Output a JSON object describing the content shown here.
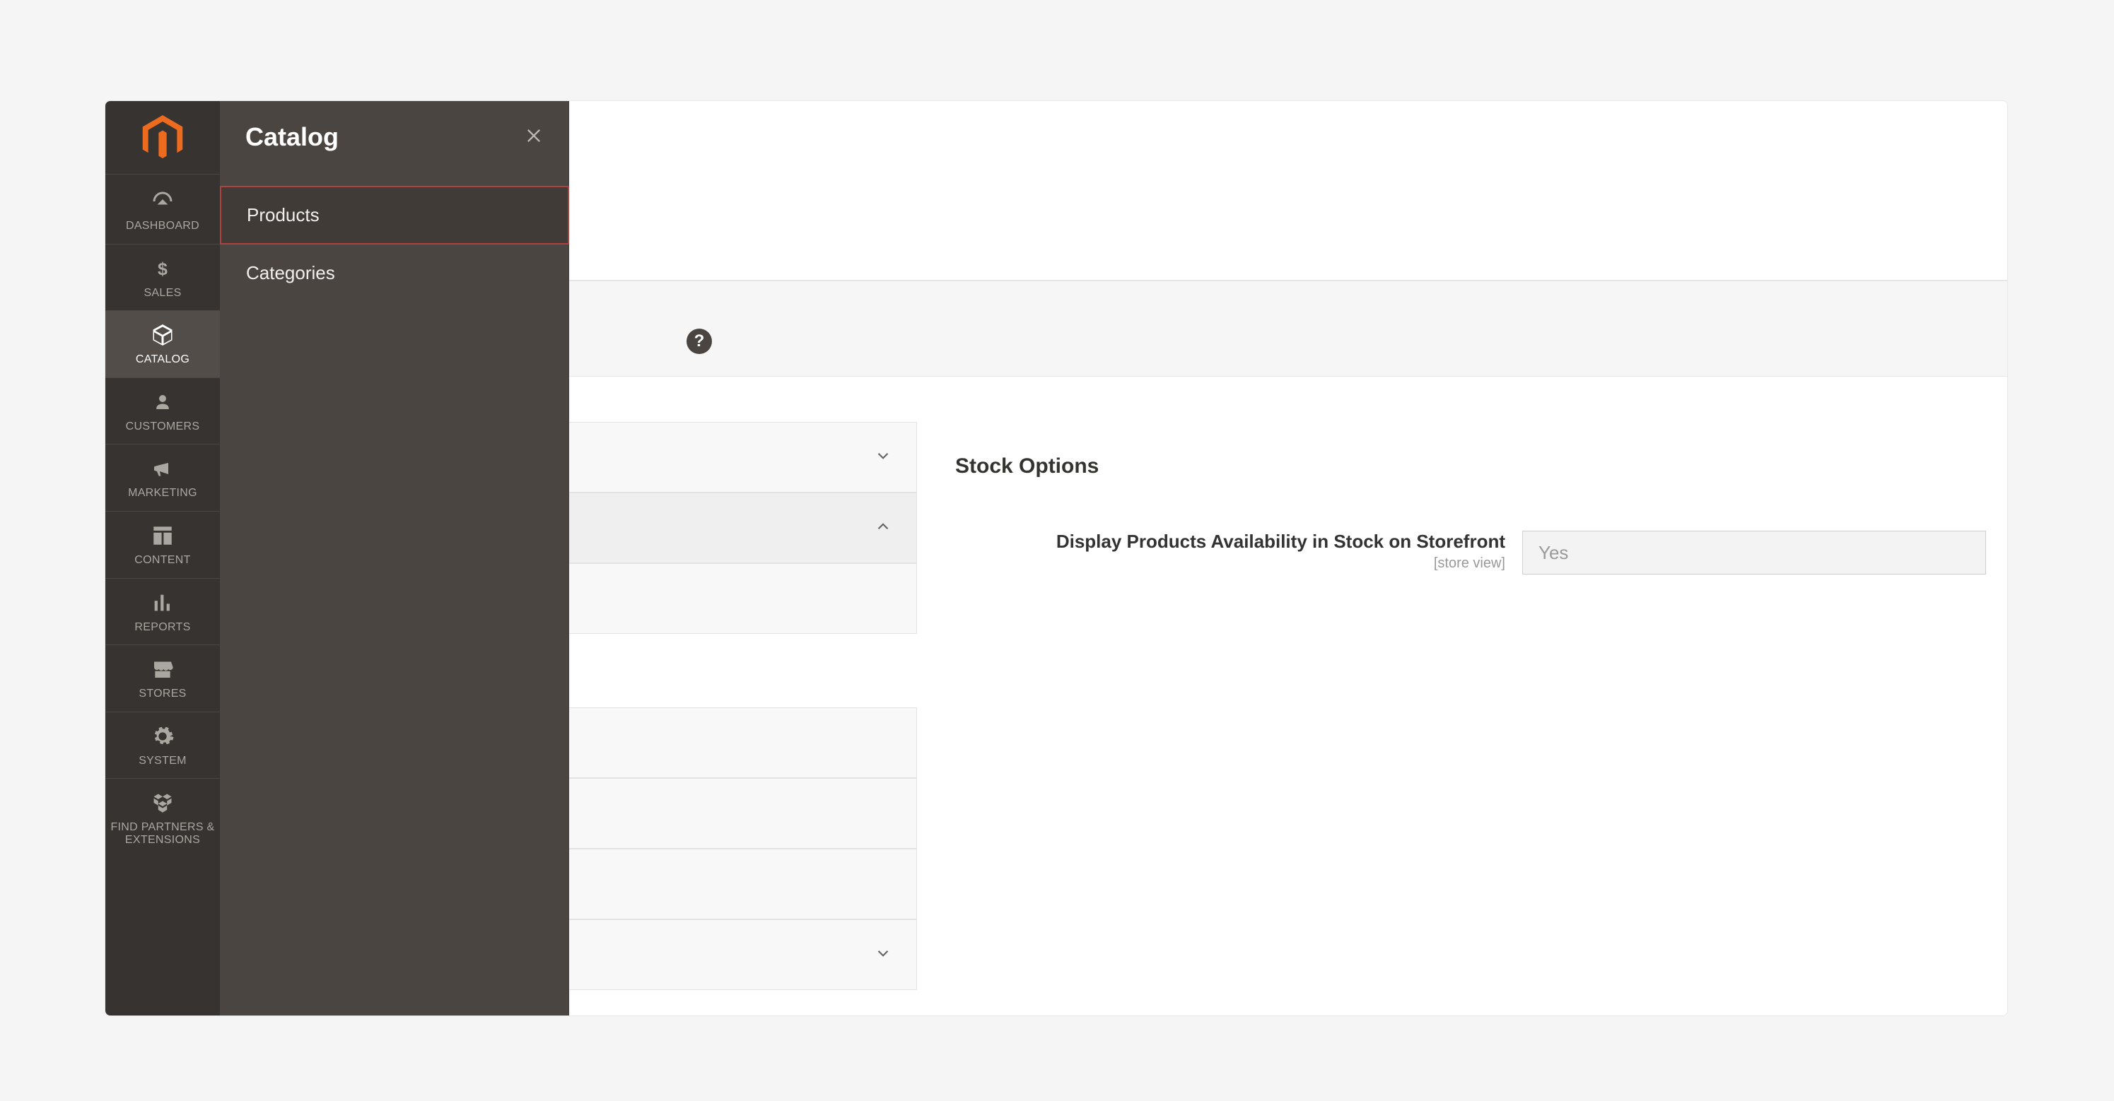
{
  "sidebar": {
    "items": [
      {
        "label": "DASHBOARD",
        "name": "sidebar-item-dashboard",
        "icon": "dashboard-icon",
        "active": false
      },
      {
        "label": "SALES",
        "name": "sidebar-item-sales",
        "icon": "dollar-icon",
        "active": false
      },
      {
        "label": "CATALOG",
        "name": "sidebar-item-catalog",
        "icon": "box-icon",
        "active": true
      },
      {
        "label": "CUSTOMERS",
        "name": "sidebar-item-customers",
        "icon": "person-icon",
        "active": false
      },
      {
        "label": "MARKETING",
        "name": "sidebar-item-marketing",
        "icon": "megaphone-icon",
        "active": false
      },
      {
        "label": "CONTENT",
        "name": "sidebar-item-content",
        "icon": "layout-icon",
        "active": false
      },
      {
        "label": "REPORTS",
        "name": "sidebar-item-reports",
        "icon": "bars-icon",
        "active": false
      },
      {
        "label": "STORES",
        "name": "sidebar-item-stores",
        "icon": "storefront-icon",
        "active": false
      },
      {
        "label": "SYSTEM",
        "name": "sidebar-item-system",
        "icon": "gear-icon",
        "active": false
      },
      {
        "label": "FIND PARTNERS\n& EXTENSIONS",
        "name": "sidebar-item-partners",
        "icon": "cubes-icon",
        "active": false
      }
    ]
  },
  "flyout": {
    "title": "Catalog",
    "items": [
      {
        "label": "Products",
        "name": "flyout-item-products",
        "highlight": true
      },
      {
        "label": "Categories",
        "name": "flyout-item-categories",
        "highlight": false
      }
    ]
  },
  "help": {
    "glyph": "?"
  },
  "section": {
    "title": "Stock Options",
    "field": {
      "label": "Display Products Availability in Stock on Storefront",
      "scope": "[store view]",
      "value": "Yes"
    }
  }
}
